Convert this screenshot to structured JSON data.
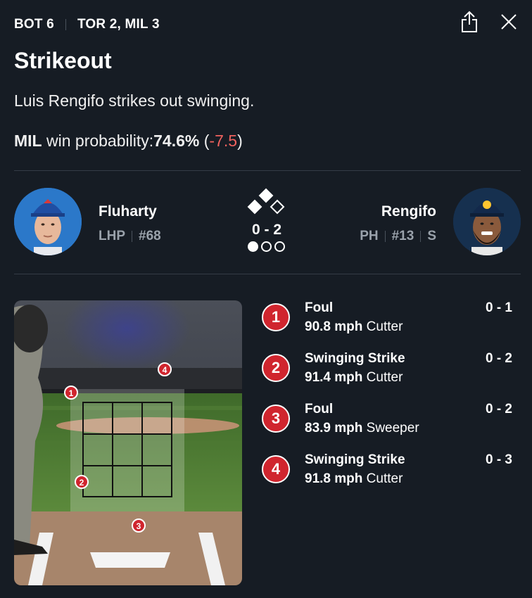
{
  "header": {
    "inning": "BOT 6",
    "score": "TOR 2, MIL 3"
  },
  "title": "Strikeout",
  "description": "Luis Rengifo strikes out swinging.",
  "win_probability": {
    "team": "MIL",
    "label": "win probability:",
    "value": "74.6%",
    "change": "-7.5",
    "change_color": "#f0625e"
  },
  "pitcher": {
    "name": "Fluharty",
    "position": "LHP",
    "number": "#68",
    "cap_color": "#1f4ea3"
  },
  "batter": {
    "name": "Rengifo",
    "position": "PH",
    "number": "#13",
    "bats": "S",
    "cap_color": "#13294b"
  },
  "situation": {
    "count": "0 - 2",
    "bases": {
      "first": false,
      "second": true,
      "third": true
    },
    "outs": 1
  },
  "pitches": [
    {
      "num": "1",
      "result": "Foul",
      "speed": "90.8 mph",
      "type": "Cutter",
      "count": "0 - 1"
    },
    {
      "num": "2",
      "result": "Swinging Strike",
      "speed": "91.4 mph",
      "type": "Cutter",
      "count": "0 - 2"
    },
    {
      "num": "3",
      "result": "Foul",
      "speed": "83.9 mph",
      "type": "Sweeper",
      "count": "0 - 2"
    },
    {
      "num": "4",
      "result": "Swinging Strike",
      "speed": "91.8 mph",
      "type": "Cutter",
      "count": "0 - 3"
    }
  ],
  "colors": {
    "background": "#161c24",
    "accent_red": "#d0252e"
  }
}
